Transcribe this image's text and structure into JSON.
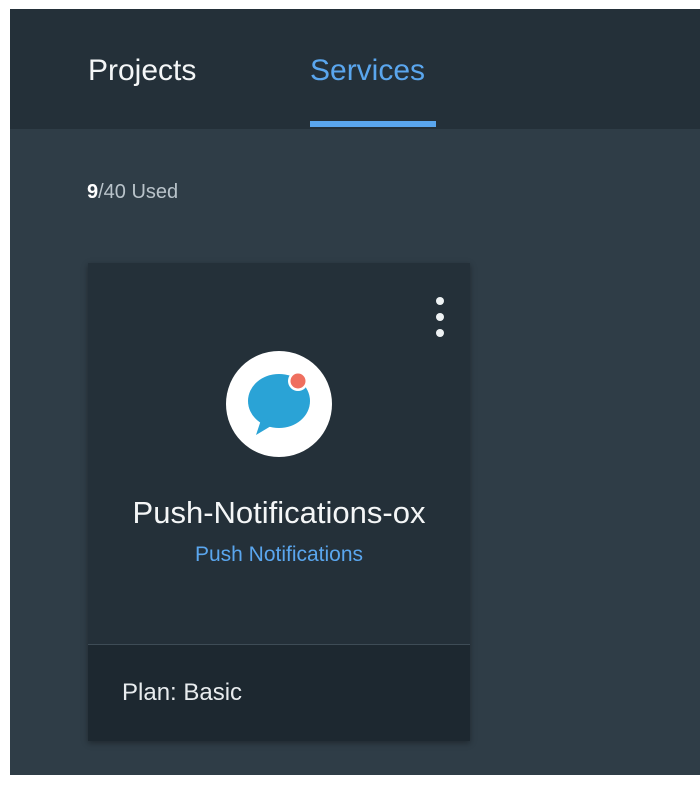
{
  "tabs": [
    {
      "label": "Projects",
      "active": false
    },
    {
      "label": "Services",
      "active": true
    }
  ],
  "usage": {
    "used": "9",
    "rest": "/40 Used"
  },
  "service_card": {
    "name": "Push-Notifications-ox",
    "type": "Push Notifications",
    "plan": "Plan: Basic",
    "icon": "chat-bubble-notification-icon",
    "menu_icon": "more-vertical-icon"
  },
  "colors": {
    "background": "#2f3d47",
    "tabbar": "#243039",
    "accent": "#5aa6ee",
    "icon_bubble": "#2aa3d6",
    "icon_badge": "#ef6f5f"
  }
}
